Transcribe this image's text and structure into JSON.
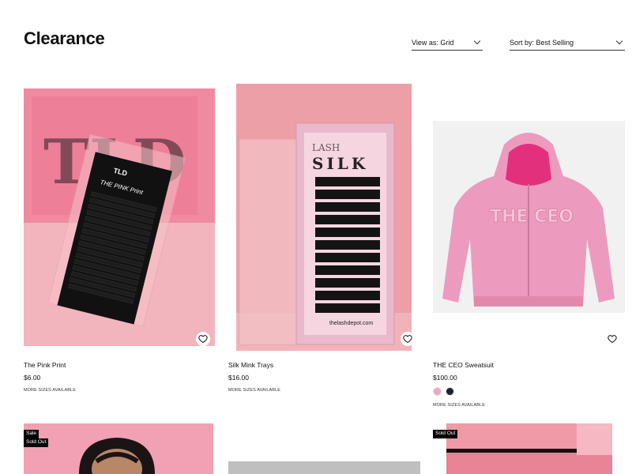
{
  "page": {
    "title": "Clearance"
  },
  "toolbar": {
    "view_label": "View as: Grid",
    "sort_label": "Sort by: Best Selling"
  },
  "products": [
    {
      "title": "The Pink Print",
      "price": "$6.00",
      "more": "MORE SIZES AVAILABLE"
    },
    {
      "title": "Silk Mink Trays",
      "price": "$16.00",
      "more": "MORE SIZES AVAILABLE"
    },
    {
      "title": "THE CEO Sweatsuit",
      "price": "$100.00",
      "more": "MORE SIZES AVAILABLE",
      "swatches": [
        "pink",
        "black"
      ]
    }
  ],
  "row2_badges": {
    "p4_sale": "Sale",
    "p4_soldout": "Sold Out",
    "p6_soldout": "Sold Out"
  },
  "colors": {
    "pink_bg": "#f2a0b3",
    "hoodie_pink": "#ec9bbf",
    "badge_bg": "#000000"
  },
  "icons": [
    "heart-icon",
    "chevron-down-icon"
  ]
}
